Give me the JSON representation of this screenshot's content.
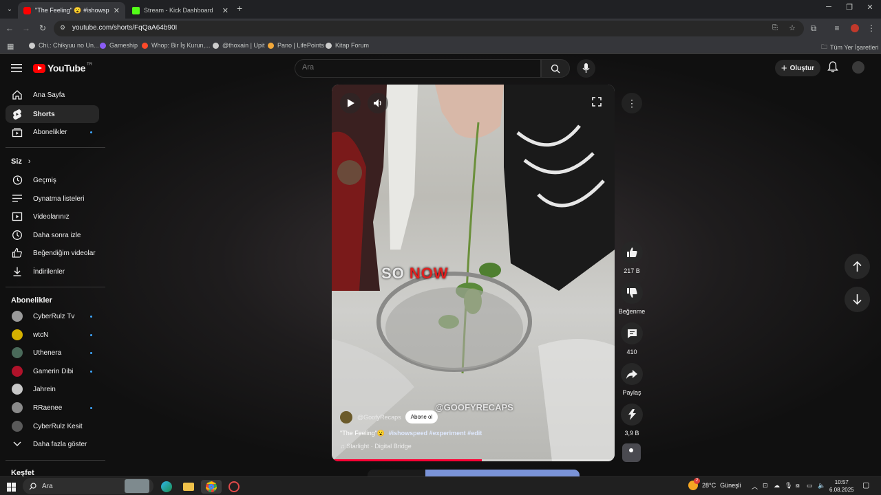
{
  "browser": {
    "tabs": [
      {
        "title": "\"The Feeling\" 😮 #ishowspeed #",
        "active": true,
        "favicon_color": "#ff0000"
      },
      {
        "title": "Stream - Kick Dashboard",
        "active": false,
        "favicon_color": "#53fc18"
      }
    ],
    "url": "youtube.com/shorts/FqQaA64b90I",
    "bookmarks": [
      {
        "label": "Chi.: Chikyuu no Un...",
        "color": "#cccccc"
      },
      {
        "label": "Gameship",
        "color": "#8b5cf6"
      },
      {
        "label": "Whop: Bir İş Kurun,...",
        "color": "#ff4a2a"
      },
      {
        "label": "@thoxain | Upit",
        "color": "#cccccc"
      },
      {
        "label": "Pano | LifePoints",
        "color": "#f2a83a"
      },
      {
        "label": "Kitap Forum",
        "color": "#cccccc"
      }
    ],
    "all_bookmarks": "Tüm Yer İşaretleri"
  },
  "youtube": {
    "logo_text": "YouTube",
    "country": "TR",
    "search_placeholder": "Ara",
    "create_label": "Oluştur",
    "sidebar": {
      "main": [
        {
          "label": "Ana Sayfa",
          "icon": "home-icon",
          "selected": false,
          "dot": false
        },
        {
          "label": "Shorts",
          "icon": "shorts-icon",
          "selected": true,
          "dot": false
        },
        {
          "label": "Abonelikler",
          "icon": "subscriptions-icon",
          "selected": false,
          "dot": true
        }
      ],
      "you_title": "Siz",
      "you": [
        {
          "label": "Geçmiş",
          "icon": "history-icon"
        },
        {
          "label": "Oynatma listeleri",
          "icon": "playlists-icon"
        },
        {
          "label": "Videolarınız",
          "icon": "your-videos-icon"
        },
        {
          "label": "Daha sonra izle",
          "icon": "watch-later-icon"
        },
        {
          "label": "Beğendiğim videolar",
          "icon": "liked-icon"
        },
        {
          "label": "İndirilenler",
          "icon": "downloads-icon"
        }
      ],
      "subs_title": "Abonelikler",
      "subs": [
        {
          "label": "CyberRulz Tv",
          "color": "#9a9a9a",
          "dot": true
        },
        {
          "label": "wtcN",
          "color": "#d4b000",
          "dot": true
        },
        {
          "label": "Uthenera",
          "color": "#4a6a5a",
          "dot": true
        },
        {
          "label": "Gamerin Dibi",
          "color": "#b0122a",
          "dot": true
        },
        {
          "label": "Jahrein",
          "color": "#c7c7c7",
          "dot": false
        },
        {
          "label": "RRaenee",
          "color": "#8a8a8a",
          "dot": true
        },
        {
          "label": "CyberRulz Kesit",
          "color": "#5a5a5a",
          "dot": false
        }
      ],
      "show_more": "Daha fazla göster",
      "explore_title": "Keşfet"
    },
    "short": {
      "overlay_text": "SO",
      "overlay_highlight": "NOW",
      "watermark": "@GOOFYRECAPS",
      "channel": "@GoofyRecaps",
      "subscribe": "Abone ol",
      "caption": "\"The Feeling\"😮",
      "hashtags": "#ishowspeed #experiment  #edit",
      "music": "Starlight · Digital Bridge",
      "progress": 0.53
    },
    "actions": {
      "likes": "217 B",
      "dislike": "Beğenme",
      "comments": "410",
      "share": "Paylaş",
      "remix": "3,9 B"
    }
  },
  "taskbar": {
    "search": "Ara",
    "weather_temp": "28°C",
    "weather_text": "Güneşli",
    "weather_badge": "2",
    "time": "10:57",
    "date": "6.08.2025"
  }
}
